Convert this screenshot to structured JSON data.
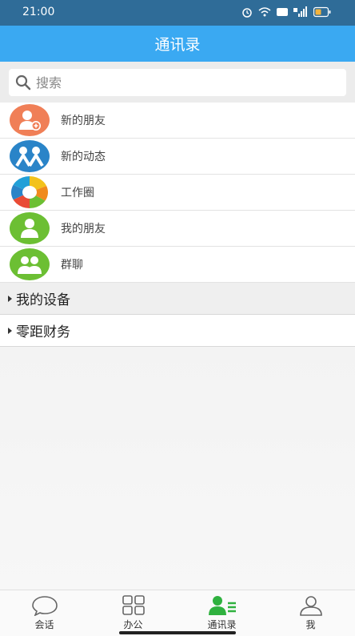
{
  "status": {
    "time": "21:00"
  },
  "header": {
    "title": "通讯录"
  },
  "search": {
    "placeholder": "搜索"
  },
  "contacts": [
    {
      "label": "新的朋友",
      "icon": "add-friend-icon",
      "color": "#f07f57"
    },
    {
      "label": "新的动态",
      "icon": "people-icon",
      "color": "#2a84c8"
    },
    {
      "label": "工作圈",
      "icon": "aperture-icon",
      "color": "#ffffff"
    },
    {
      "label": "我的朋友",
      "icon": "person-icon",
      "color": "#6cbf33"
    },
    {
      "label": "群聊",
      "icon": "group-icon",
      "color": "#6cbf33"
    }
  ],
  "groups": [
    {
      "label": "我的设备"
    },
    {
      "label": "零距财务"
    }
  ],
  "tabs": [
    {
      "label": "会话",
      "icon": "chat-bubble-icon"
    },
    {
      "label": "办公",
      "icon": "grid-icon"
    },
    {
      "label": "通讯录",
      "icon": "contacts-icon",
      "active": true
    },
    {
      "label": "我",
      "icon": "user-icon"
    }
  ],
  "colors": {
    "status_bar": "#2f6c98",
    "title_bar": "#3aa9f2",
    "active_tab": "#2fb13f"
  }
}
